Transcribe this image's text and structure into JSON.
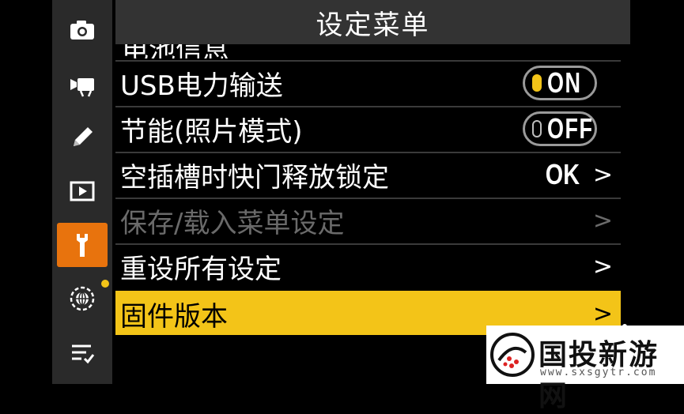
{
  "header": {
    "title": "设定菜单"
  },
  "sidebar": {
    "items": [
      {
        "name": "photo-shooting-menu",
        "icon": "camera-icon"
      },
      {
        "name": "movie-recording-menu",
        "icon": "movie-camera-icon"
      },
      {
        "name": "custom-settings-menu",
        "icon": "pencil-icon"
      },
      {
        "name": "playback-menu",
        "icon": "play-icon"
      },
      {
        "name": "setup-menu",
        "icon": "wrench-icon",
        "active": true
      },
      {
        "name": "network-menu",
        "icon": "network-globe-icon",
        "badge": true
      },
      {
        "name": "my-menu",
        "icon": "list-check-icon"
      }
    ]
  },
  "menu": {
    "partial_label": "电池信息",
    "items": [
      {
        "label": "USB电力输送",
        "toggle": "ON"
      },
      {
        "label": "节能(照片模式)",
        "toggle": "OFF"
      },
      {
        "label": "空插槽时快门释放锁定",
        "value": "OK",
        "chevron": ">"
      },
      {
        "label": "保存/载入菜单设定",
        "chevron": ">",
        "disabled": true
      },
      {
        "label": "重设所有设定",
        "chevron": ">"
      },
      {
        "label": "固件版本",
        "chevron": ">",
        "selected": true
      }
    ]
  },
  "watermark": {
    "title": "国投新游网",
    "url": "www.sxsgytr.com"
  },
  "colors": {
    "accent": "#f3c418",
    "active_tab": "#e8730d",
    "sidebar": "#2a2a2a",
    "title_bar": "#333333"
  }
}
